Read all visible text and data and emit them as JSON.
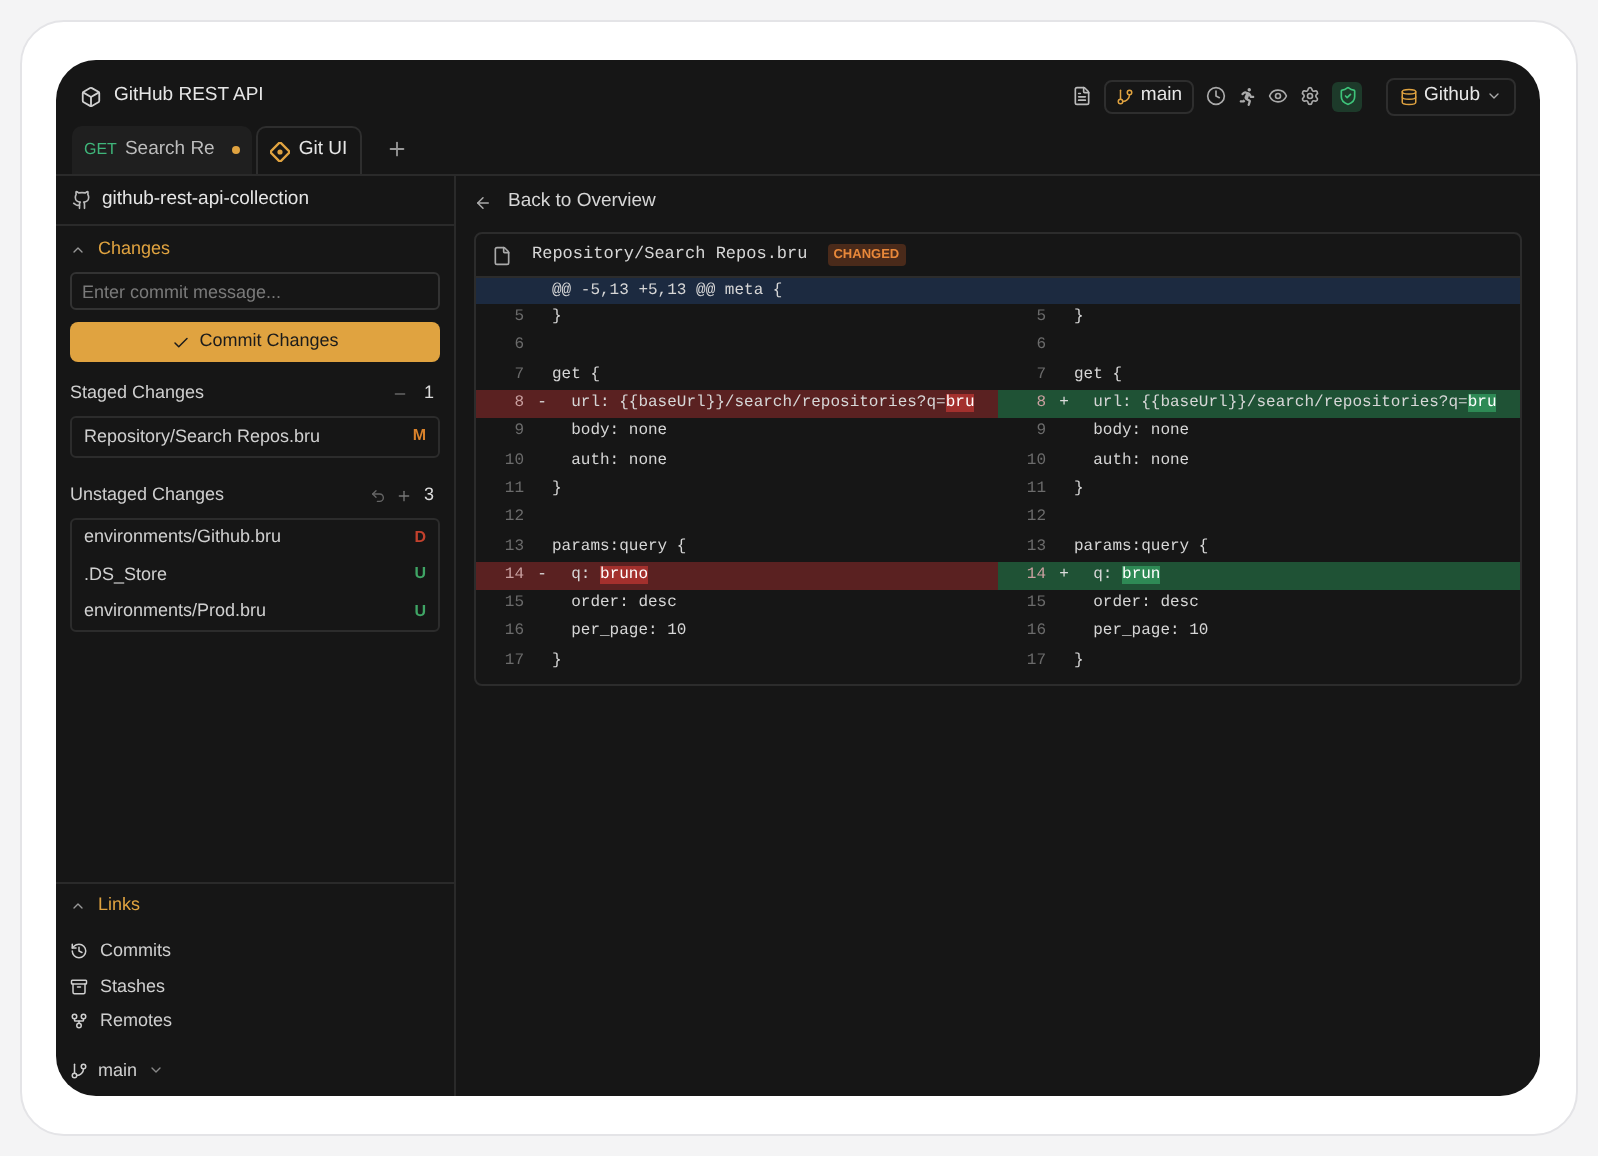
{
  "window": {
    "title": "GitHub REST API"
  },
  "toolbar": {
    "branch": "main",
    "environment": "Github"
  },
  "tabs": [
    {
      "kind": "request",
      "method": "GET",
      "label": "Search Re",
      "unsaved": true,
      "selected": false
    },
    {
      "kind": "git",
      "label": "Git UI",
      "selected": true
    }
  ],
  "sidebar": {
    "repository": "github-rest-api-collection",
    "changes": {
      "title": "Changes",
      "expanded": true,
      "commit_placeholder": "Enter commit message...",
      "commit_button": "Commit Changes",
      "staged": {
        "title": "Staged Changes",
        "count": "1",
        "files": [
          {
            "path": "Repository/Search Repos.bru",
            "status": "M",
            "color": "#d9822b"
          }
        ]
      },
      "unstaged": {
        "title": "Unstaged Changes",
        "count": "3",
        "files": [
          {
            "path": "environments/Github.bru",
            "status": "D",
            "color": "#c2412d"
          },
          {
            "path": ".DS_Store",
            "status": "U",
            "color": "#3fa565"
          },
          {
            "path": "environments/Prod.bru",
            "status": "U",
            "color": "#3fa565"
          }
        ]
      }
    },
    "links": {
      "title": "Links",
      "expanded": true,
      "items": [
        {
          "kind": "commits",
          "label": "Commits"
        },
        {
          "kind": "stashes",
          "label": "Stashes"
        },
        {
          "kind": "remotes",
          "label": "Remotes"
        }
      ]
    },
    "branch": "main"
  },
  "back_link": "Back to Overview",
  "diff": {
    "file": "Repository/Search Repos.bru",
    "badge": "CHANGED",
    "hunk": "@@ -5,13 +5,13 @@ meta {",
    "rows": [
      {
        "kind": "context",
        "left": {
          "no": "5",
          "text": "}"
        },
        "right": {
          "no": "5",
          "text": "}"
        }
      },
      {
        "kind": "context",
        "left": {
          "no": "6"
        },
        "right": {
          "no": "6"
        }
      },
      {
        "kind": "context",
        "left": {
          "no": "7",
          "text": "get {"
        },
        "right": {
          "no": "7",
          "text": "get {"
        }
      },
      {
        "kind": "changed",
        "left": {
          "no": "8",
          "sign": "-",
          "text": "  url: {{baseUrl}}/search/repositories?q=",
          "highlight": "bru"
        },
        "right": {
          "no": "8",
          "sign": "+",
          "text": "  url: {{baseUrl}}/search/repositories?q=",
          "highlight": "bru"
        }
      },
      {
        "kind": "context",
        "left": {
          "no": "9",
          "text": "  body: none"
        },
        "right": {
          "no": "9",
          "text": "  body: none"
        }
      },
      {
        "kind": "context",
        "left": {
          "no": "10",
          "text": "  auth: none"
        },
        "right": {
          "no": "10",
          "text": "  auth: none"
        }
      },
      {
        "kind": "context",
        "left": {
          "no": "11",
          "text": "}"
        },
        "right": {
          "no": "11",
          "text": "}"
        }
      },
      {
        "kind": "context",
        "left": {
          "no": "12"
        },
        "right": {
          "no": "12"
        }
      },
      {
        "kind": "context",
        "left": {
          "no": "13",
          "text": "params:query {"
        },
        "right": {
          "no": "13",
          "text": "params:query {"
        }
      },
      {
        "kind": "changed",
        "left": {
          "no": "14",
          "sign": "-",
          "text": "  q: ",
          "highlight": "bruno"
        },
        "right": {
          "no": "14",
          "sign": "+",
          "text": "  q: ",
          "highlight": "brun"
        }
      },
      {
        "kind": "context",
        "left": {
          "no": "15",
          "text": "  order: desc"
        },
        "right": {
          "no": "15",
          "text": "  order: desc"
        }
      },
      {
        "kind": "context",
        "left": {
          "no": "16",
          "text": "  per_page: 10"
        },
        "right": {
          "no": "16",
          "text": "  per_page: 10"
        }
      },
      {
        "kind": "context",
        "left": {
          "no": "17",
          "text": "}"
        },
        "right": {
          "no": "17",
          "text": "}"
        }
      }
    ]
  }
}
